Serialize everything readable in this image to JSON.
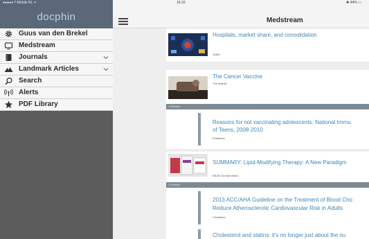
{
  "status_bar": {
    "carrier": "●●●●● T-Mobile NL ᯤ",
    "time": "16:10",
    "battery": "✱ 44% ▭"
  },
  "sidebar": {
    "logo": "docphin",
    "items": [
      {
        "label": "Guus van den Brekel",
        "icon": "gear-icon",
        "has_chevron": false
      },
      {
        "label": "Medstream",
        "icon": "monitor-icon",
        "has_chevron": false
      },
      {
        "label": "Journals",
        "icon": "journal-icon",
        "has_chevron": true
      },
      {
        "label": "Landmark Articles",
        "icon": "mountain-icon",
        "has_chevron": true
      },
      {
        "label": "Search",
        "icon": "search-icon",
        "has_chevron": false
      },
      {
        "label": "Alerts",
        "icon": "broadcast-icon",
        "has_chevron": false
      },
      {
        "label": "PDF Library",
        "icon": "star-icon",
        "has_chevron": false
      }
    ]
  },
  "header": {
    "menu_icon": "hamburger-icon",
    "title": "Medstream"
  },
  "feed": {
    "articles": [
      {
        "title": "Hospitals, market share, and consolidation",
        "source": "JAMA"
      },
      {
        "title": "The Cancer Vaccine",
        "source": "The Atlantic",
        "related_label": "1 Related",
        "related": [
          {
            "title_lines": [
              "Reasons for not vaccinating adolescents: National Immu",
              "of Teens, 2008-2010"
            ],
            "source": "Pediatrics"
          }
        ]
      },
      {
        "title": "SUMMARY: Lipid-Modifying Therapy: A New Paradigm",
        "source": "NEJM Journal Watch",
        "related_label": "2 Related",
        "related": [
          {
            "title_lines": [
              "2013 ACC/AHA Guideline on the Treatment of Blood Cho",
              "Reduce Atherosclerotic Cardiovascular Risk in Adults"
            ],
            "source": "Circulation"
          },
          {
            "title_lines": [
              "Cholesterol and statins: it's no longer just about the nu"
            ],
            "source": ""
          }
        ]
      }
    ]
  },
  "colors": {
    "sidebar_bg": "#5c5c5c",
    "brand_bar": "#5a6878",
    "logo": "#b9d3ec",
    "link": "#3d86b8",
    "related_bar": "#7d8a94"
  }
}
